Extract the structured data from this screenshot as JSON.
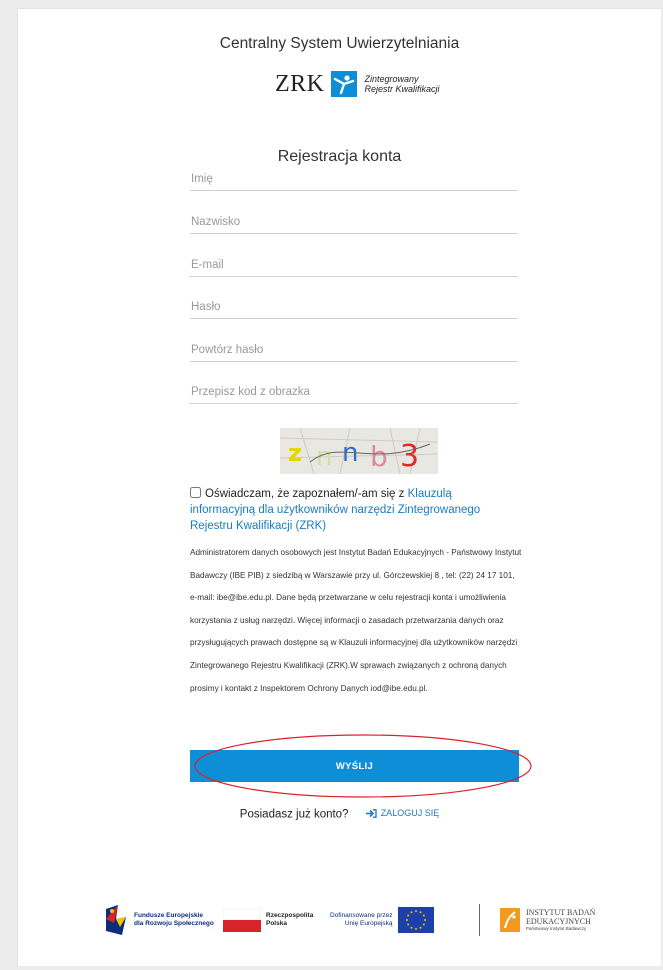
{
  "header": {
    "system_title": "Centralny System Uwierzytelniania",
    "logo_text": "ZRK",
    "logo_sub_line1": "Zintegrowany",
    "logo_sub_line2": "Rejestr Kwalifikacji"
  },
  "form": {
    "title": "Rejestracja konta",
    "fields": [
      {
        "placeholder": "Imię",
        "value": ""
      },
      {
        "placeholder": "Nazwisko",
        "value": ""
      },
      {
        "placeholder": "E-mail",
        "value": ""
      },
      {
        "placeholder": "Hasło",
        "value": ""
      },
      {
        "placeholder": "Powtórz hasło",
        "value": ""
      },
      {
        "placeholder": "Przepisz kod z obrazka",
        "value": ""
      }
    ],
    "captcha_text": "znnb3",
    "consent": {
      "checked": false,
      "text": "Oświadczam, że zapoznałem/-am się z ",
      "link_text": "Klauzulą informacyjną dla użytkowników narzędzi Zintegrowanego Rejestru Kwalifikacji (ZRK)"
    },
    "info_text": "Administratorem danych osobowych jest Instytut Badań Edukacyjnych - Państwowy Instytut Badawczy (IBE PIB) z siedzibą w Warszawie przy ul. Górczewskiej 8 , tel: (22) 24 17 101, e-mail: ibe@ibe.edu.pl. Dane będą przetwarzane w celu rejestracji konta i umożliwienia korzystania z usług narzędzi. Więcej informacji o zasadach przetwarzania danych oraz przysługujących prawach dostępne są w Klauzuli informacyjnej dla użytkowników narzędzi Zintegrowanego Rejestru Kwalifikacji (ZRK).W sprawach związanych z ochroną danych prosimy i kontakt z Inspektorem Ochrony Danych iod@ibe.edu.pl.",
    "submit_label": "WYŚLIJ",
    "have_account_text": "Posiadasz już konto?",
    "login_label": "ZALOGUJ SIĘ"
  },
  "footer": {
    "fe_line1": "Fundusze Europejskie",
    "fe_line2": "dla Rozwoju Społecznego",
    "rp_line1": "Rzeczpospolita",
    "rp_line2": "Polska",
    "eu_line1": "Dofinansowane przez",
    "eu_line2": "Unię Europejską",
    "ibe_line1": "INSTYTUT BADAŃ",
    "ibe_line2": "EDUKACYJNYCH",
    "ibe_line3": "Państwowy Instytut Badawczy"
  },
  "colors": {
    "accent": "#0f8ed8",
    "link": "#1a7bbf",
    "annotation": "#d9232a"
  }
}
